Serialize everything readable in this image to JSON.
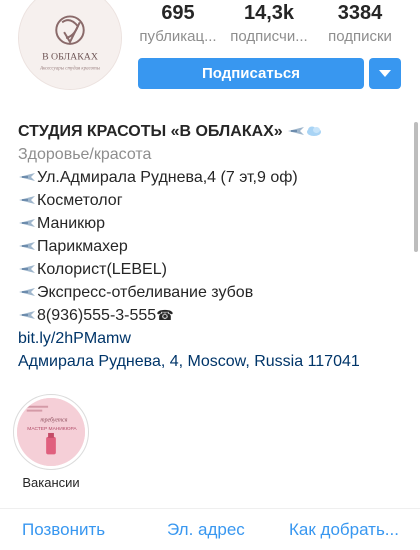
{
  "profile": {
    "avatar_text": "В ОБЛАКАХ",
    "avatar_subtext": "Аксессуары студия красоты"
  },
  "stats": [
    {
      "value": "695",
      "label": "публикац..."
    },
    {
      "value": "14,3k",
      "label": "подписчи..."
    },
    {
      "value": "3384",
      "label": "подписки"
    }
  ],
  "actions": {
    "follow_label": "Подписаться"
  },
  "bio": {
    "name": "СТУДИЯ КРАСОТЫ «В ОБЛАКАХ»",
    "category": "Здоровье/красота",
    "lines": [
      "Ул.Адмирала Руднева,4 (7 эт,9 оф)",
      "Косметолог",
      "Маникюр",
      "Парикмахер",
      "Колорист(LEBEL)",
      "Экспресс-отбеливание зубов",
      "8(936)555-3-555"
    ],
    "phone_glyph": "☎",
    "link": "bit.ly/2hPMamw",
    "address": "Адмирала Руднева, 4, Moscow, Russia 117041"
  },
  "highlights": [
    {
      "label": "Вакансии",
      "cover_text_1": "требуется",
      "cover_text_2": "МАСТЕР МАНИКЮРА"
    }
  ],
  "bottom_actions": [
    "Позвонить",
    "Эл. адрес",
    "Как добрать..."
  ],
  "colors": {
    "accent": "#3897f0",
    "link": "#003569",
    "muted": "#8e8e8e"
  },
  "icons": [
    "airplane-icon",
    "cloud-icon",
    "telephone-icon",
    "chevron-down-icon"
  ]
}
